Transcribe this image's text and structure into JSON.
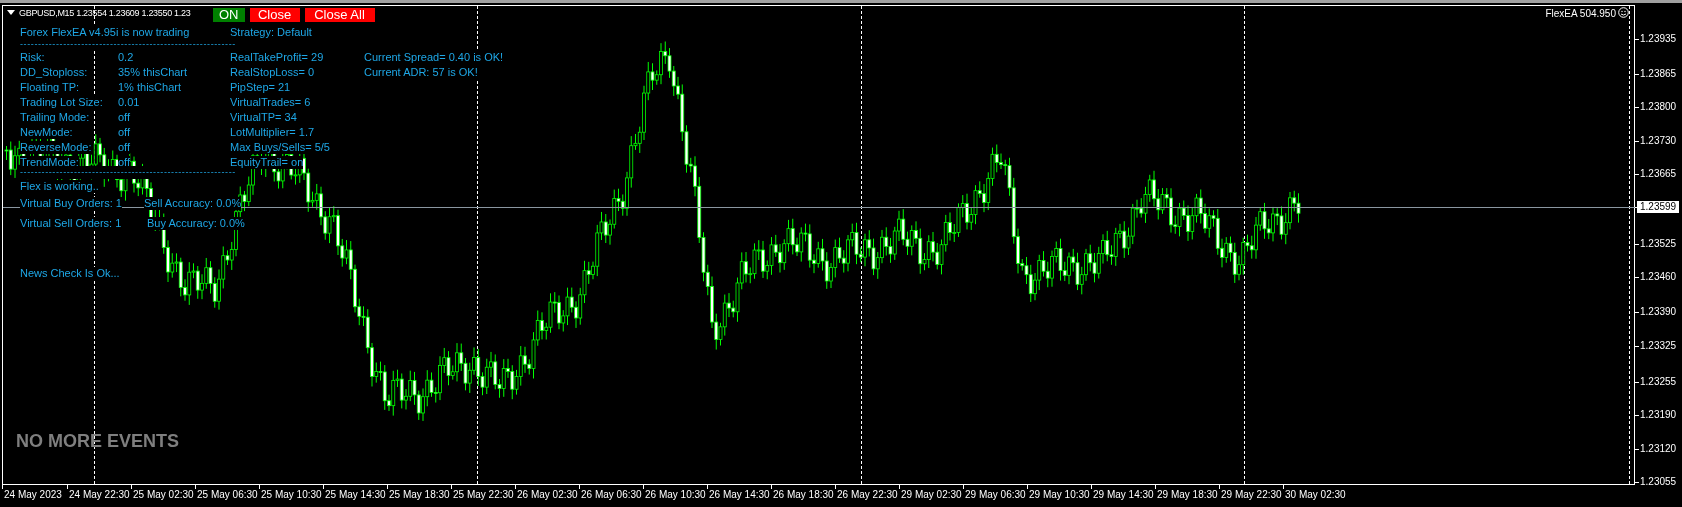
{
  "chart_header": {
    "symbol_text": "GBPUSD,M15  1.23554 1.23609 1.23550 1.23",
    "corner_label": "FlexEA 504.950"
  },
  "buttons": [
    {
      "label": "ON",
      "color": "#008000"
    },
    {
      "label": "Close",
      "color": "#ff0000"
    },
    {
      "label": "Close All",
      "color": "#ff0000"
    }
  ],
  "ea_panel": {
    "title": "Forex FlexEA v4.95i is now trading",
    "strategy": "Strategy: Default",
    "separator": "------------------------------------------------------------",
    "settings": [
      {
        "label": "Risk:",
        "value": "0.2"
      },
      {
        "label": "DD_Stoploss:",
        "value": "35%  thisChart"
      },
      {
        "label": "Floating TP:",
        "value": "1%  thisChart"
      },
      {
        "label": "Trading Lot Size:",
        "value": "0.01"
      },
      {
        "label": "Trailing Mode:",
        "value": "off"
      },
      {
        "label": "NewMode:",
        "value": "off"
      },
      {
        "label": "ReverseMode:",
        "value": "off"
      },
      {
        "label": "TrendMode:",
        "value": "off"
      }
    ],
    "params": [
      "RealTakeProfit= 29",
      "RealStopLoss= 0",
      "PipStep= 21",
      "VirtualTrades= 6",
      "VirtualTP= 34",
      "LotMultiplier= 1.7",
      "Max Buys/Sells= 5/5",
      "EquityTrail= on"
    ],
    "checks": [
      "Current Spread= 0.40 is OK!",
      "Current ADR: 57  is OK!"
    ],
    "separator_2": "------------------------------------------------------------",
    "status": "Flex is working..",
    "orders": [
      {
        "text": "Virtual Buy Orders: 1",
        "accuracy": "Sell Accuracy: 0.0%"
      },
      {
        "text": "Virtual Sell Orders: 1",
        "accuracy": "Buy Accuracy: 0.0%"
      }
    ],
    "news": "News Check Is Ok..."
  },
  "events_label": "NO MORE EVENTS",
  "price_axis": [
    {
      "label": "1.23935",
      "selected": false
    },
    {
      "label": "1.23865",
      "selected": false
    },
    {
      "label": "1.23800",
      "selected": false
    },
    {
      "label": "1.23730",
      "selected": false
    },
    {
      "label": "1.23665",
      "selected": false
    },
    {
      "label": "1.23599",
      "selected": true
    },
    {
      "label": "1.23525",
      "selected": false
    },
    {
      "label": "1.23460",
      "selected": false
    },
    {
      "label": "1.23390",
      "selected": false
    },
    {
      "label": "1.23325",
      "selected": false
    },
    {
      "label": "1.23255",
      "selected": false
    },
    {
      "label": "1.23190",
      "selected": false
    },
    {
      "label": "1.23120",
      "selected": false
    },
    {
      "label": "1.23055",
      "selected": false
    }
  ],
  "time_axis": [
    "24 May 2023",
    "24 May 22:30",
    "25 May 02:30",
    "25 May 06:30",
    "25 May 10:30",
    "25 May 14:30",
    "25 May 18:30",
    "25 May 22:30",
    "26 May 02:30",
    "26 May 06:30",
    "26 May 10:30",
    "26 May 14:30",
    "26 May 18:30",
    "26 May 22:30",
    "29 May 02:30",
    "29 May 06:30",
    "29 May 10:30",
    "29 May 14:30",
    "29 May 18:30",
    "29 May 22:30",
    "30 May 02:30"
  ]
}
